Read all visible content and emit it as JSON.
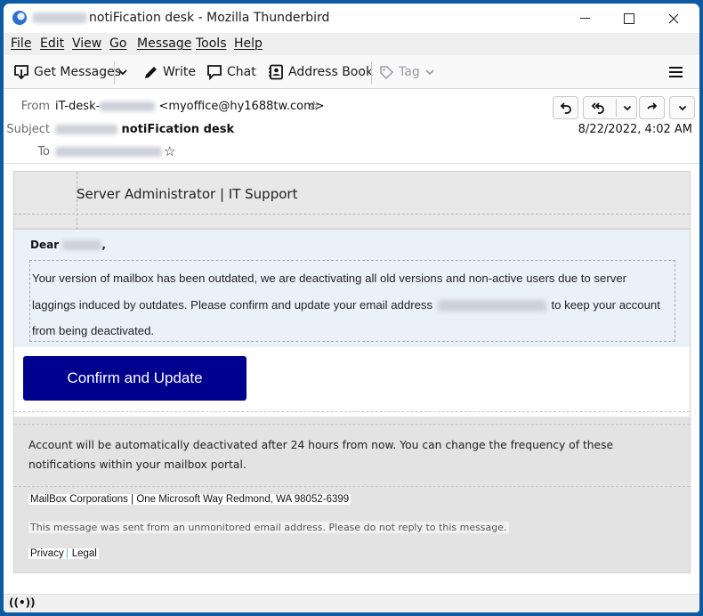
{
  "window": {
    "title": "notiFication desk - Mozilla Thunderbird",
    "controls": {
      "minimize": "minimize",
      "maximize": "maximize",
      "close": "×"
    }
  },
  "menu": [
    "File",
    "Edit",
    "View",
    "Go",
    "Message",
    "Tools",
    "Help"
  ],
  "toolbar": {
    "get_messages": "Get Messages",
    "write": "Write",
    "chat": "Chat",
    "address_book": "Address Book",
    "tag": "Tag",
    "icons": [
      "download-icon",
      "chevron-down-icon",
      "pencil-icon",
      "chat-bubble-icon",
      "address-book-icon",
      "tag-icon",
      "hamburger-menu-icon"
    ]
  },
  "header": {
    "from_label": "From",
    "from_name": "iT-desk-",
    "from_email": "<myoffice@hy1688tw.com>",
    "subject_label": "Subject",
    "subject": "notiFication desk",
    "to_label": "To",
    "date": "8/22/2022, 4:02 AM",
    "actions": [
      "reply",
      "reply-all",
      "more",
      "forward",
      "more"
    ]
  },
  "email": {
    "sender_title": "Server Administrator | IT Support",
    "greeting_prefix": "Dear",
    "greeting_suffix": ",",
    "body_line1": "Your version of mailbox has been outdated, we are deactivating all old versions and non-active users due to server",
    "body_line2_a": "laggings induced by outdates. Please confirm and update your  email address",
    "body_line2_b": "to keep your account",
    "body_line3": "from being deactivated.",
    "cta_label": "Confirm and Update",
    "cta_color": "#00008f",
    "warning": "Account will be automatically deactivated after 24 hours from now. You can change the frequency of these notifications within your mailbox portal.",
    "address": "MailBox Corporations | One Microsoft Way Redmond, WA 98052-6399",
    "no_reply": "This message was sent from an unmonitored email address. Please do not reply to this message.",
    "privacy": "Privacy",
    "pipe": "|",
    "legal": "Legal"
  },
  "status": {
    "icon": "((•))"
  }
}
